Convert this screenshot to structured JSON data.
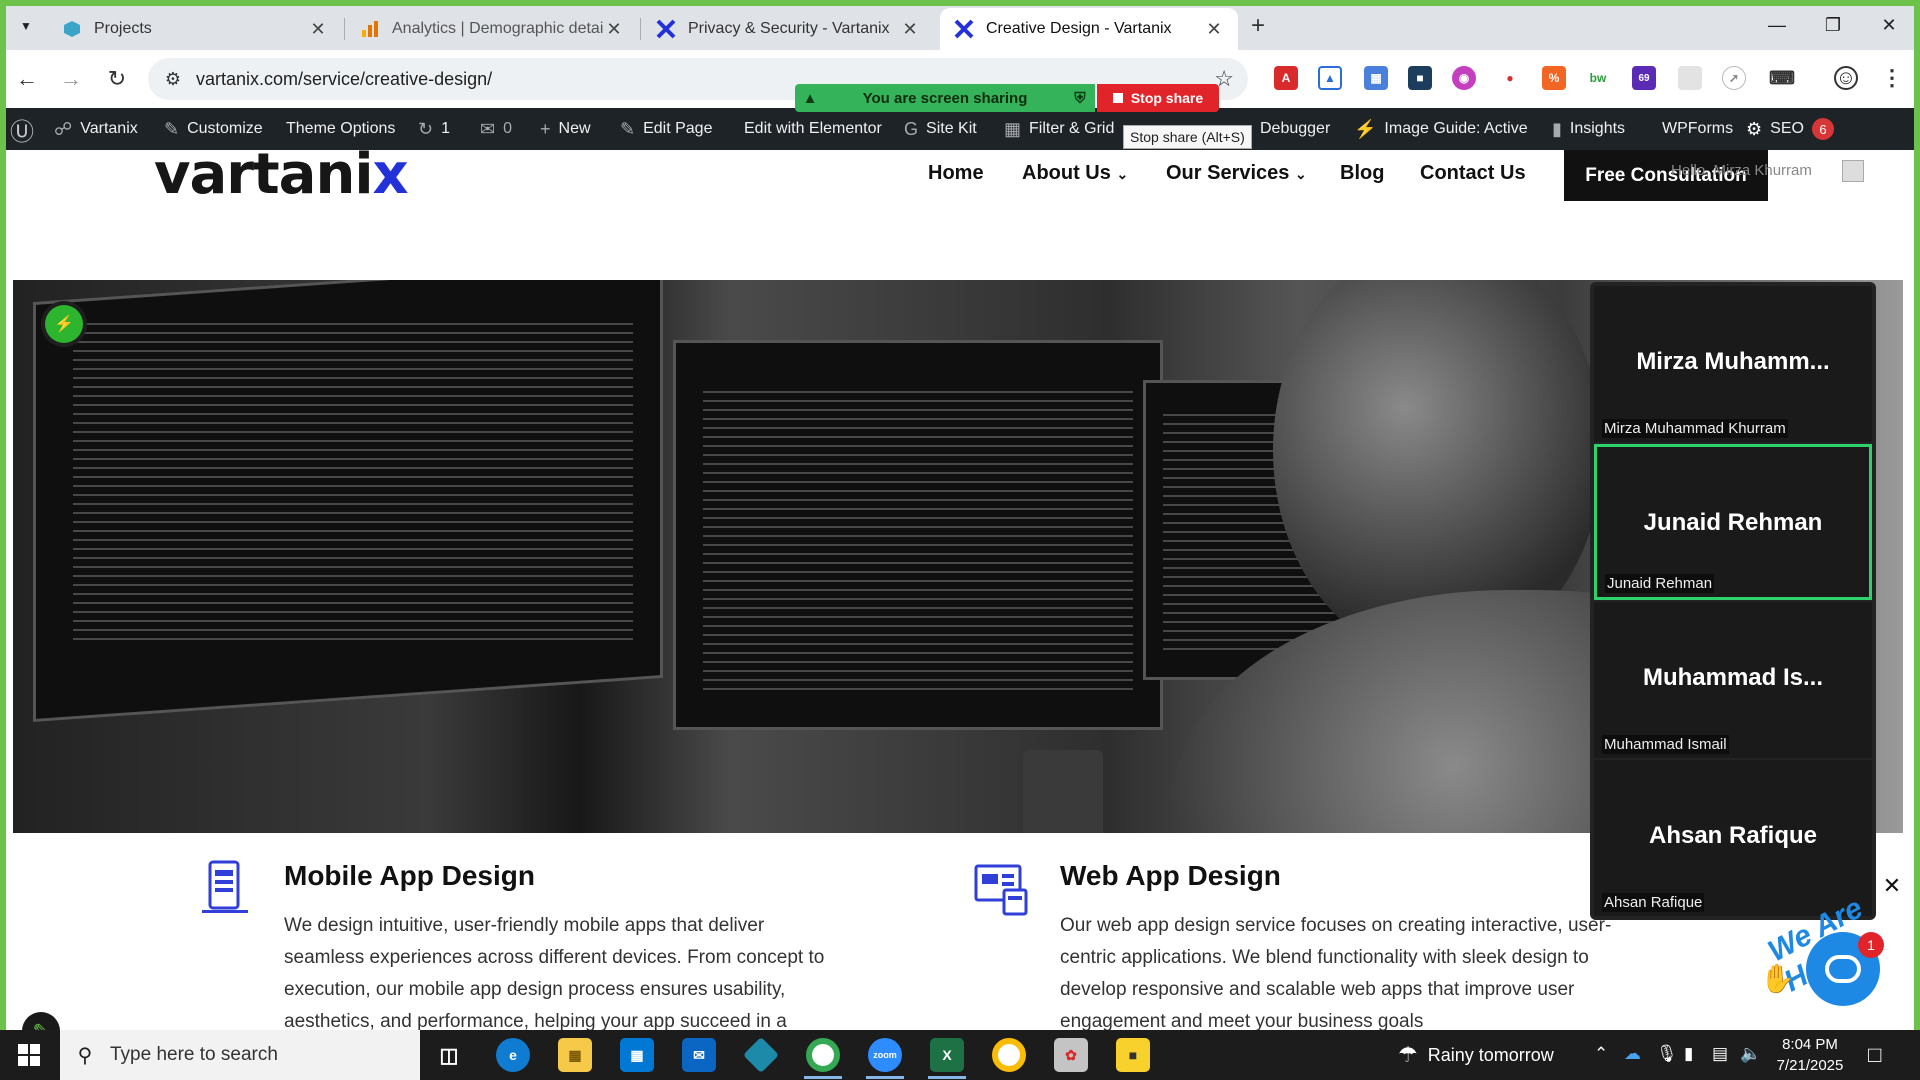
{
  "browser": {
    "tabs": [
      {
        "title": "Projects",
        "active": false
      },
      {
        "title": "Analytics | Demographic details",
        "active": false
      },
      {
        "title": "Privacy & Security - Vartanix",
        "active": false
      },
      {
        "title": "Creative Design - Vartanix",
        "active": true
      }
    ],
    "url": "vartanix.com/service/creative-design/",
    "extension_badge": "69"
  },
  "screen_share": {
    "status": "You are screen sharing",
    "stop_label": "Stop share",
    "stop_tooltip": "Stop share (Alt+S)"
  },
  "wp_admin_bar": {
    "site_name": "Vartanix",
    "customize": "Customize",
    "theme_options": "Theme Options",
    "updates_count": "1",
    "comments_count": "0",
    "new": "New",
    "edit_page": "Edit Page",
    "edit_elementor": "Edit with Elementor",
    "site_kit": "Site Kit",
    "filter_grid": "Filter & Grid",
    "debugger": "Debugger",
    "image_guide": "Image Guide: Active",
    "insights": "Insights",
    "wpforms": "WPForms",
    "seo": "SEO",
    "seo_badge": "6"
  },
  "site": {
    "logo_main": "varta",
    "logo_tail": "ni",
    "logo_x": "x",
    "menu": {
      "home": "Home",
      "about": "About Us",
      "services": "Our Services",
      "blog": "Blog",
      "contact": "Contact Us"
    },
    "cta": "Free Consultation",
    "cta_overlap": "Hello, Mirza Khurram",
    "services": [
      {
        "title": "Mobile App Design",
        "text": "We design intuitive, user-friendly mobile apps that deliver seamless experiences across different devices. From concept to execution, our mobile app design process ensures usability, aesthetics, and performance, helping your app succeed in a"
      },
      {
        "title": "Web App Design",
        "text": "Our web app design service focuses on creating interactive, user-centric applications. We blend functionality with sleek design to develop responsive and scalable web apps that improve user engagement and meet your business goals"
      }
    ],
    "chat_badge": "1",
    "chat_text": "We Are Here!"
  },
  "zoom_panel": {
    "participants": [
      {
        "display": "Mirza  Muhamm...",
        "name": "Mirza Muhammad Khurram",
        "active": false
      },
      {
        "display": "Junaid Rehman",
        "name": "Junaid Rehman",
        "active": true
      },
      {
        "display": "Muhammad  Is...",
        "name": "Muhammad Ismail",
        "active": false
      },
      {
        "display": "Ahsan Rafique",
        "name": "Ahsan Rafique",
        "active": false
      }
    ]
  },
  "taskbar": {
    "search_placeholder": "Type here to search",
    "weather": "Rainy tomorrow",
    "time": "8:04 PM",
    "date": "7/21/2025"
  }
}
